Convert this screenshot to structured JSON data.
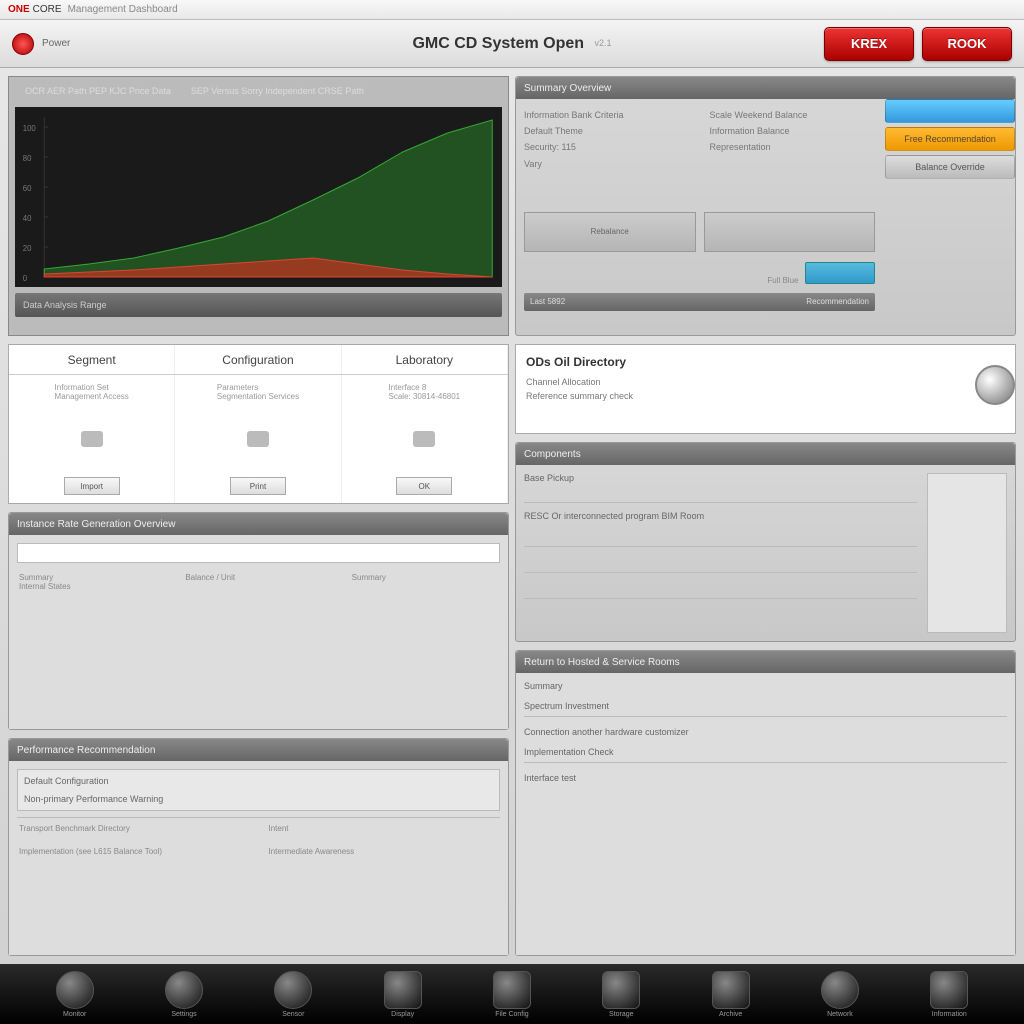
{
  "topbar": {
    "brand": "ONE",
    "brand2": "CORE",
    "subtitle": "Management Dashboard"
  },
  "header": {
    "icon_label": "Power",
    "title": "GMC CD System Open",
    "sub": "v2.1",
    "btn1": "KREX",
    "btn2": "ROOK"
  },
  "left": {
    "chart": {
      "tab1": "OCR AER Path PEP KJC Price Data",
      "tab2": "SEP Versus Sorry Independent CRSE Path",
      "footer": "Data Analysis Range"
    },
    "tricard": {
      "h1": "Segment",
      "h2": "Configuration",
      "h3": "Laboratory",
      "sub1a": "Information Set",
      "sub1b": "Management Access",
      "sub2a": "Parameters",
      "sub2b": "Segmentation Services",
      "sub3a": "Interface 8",
      "sub3b": "Scale: 30814-46801",
      "btn1": "Import",
      "btn2": "Print",
      "btn3": "OK"
    },
    "panelA": {
      "title": "Instance Rate Generation Overview",
      "c1h": "Summary",
      "c1a": "Internal States",
      "c2h": "Balance / Unit",
      "c3h": "Summary"
    },
    "panelB": {
      "title": "Performance Recommendation",
      "l1": "Default Configuration",
      "l2": "Non-primary Performance Warning",
      "f1": "Transport Benchmark Directory",
      "f2": "Implementation (see L615 Balance Tool)",
      "f3": "Intent",
      "f4": "Intermediate Awareness"
    }
  },
  "right": {
    "summary": {
      "title": "Summary Overview",
      "l1": "Information Bank Criteria",
      "l2": "Default Theme",
      "l3": "Security: 115",
      "l4": "Vary",
      "r1": "Scale Weekend Balance",
      "r2": "Information Balance",
      "r3": "Representation",
      "act1": "",
      "act2": "Free Recommendation",
      "act3": "Balance Override",
      "box1": "Rebalance",
      "box2": "",
      "pill_label": "Full Blue",
      "strip_l": "Last 5892",
      "strip_r": "Recommendation"
    },
    "info": {
      "title": "ODs Oil Directory",
      "l1": "Channel Allocation",
      "l2": "Reference summary check"
    },
    "panelC": {
      "title": "Components",
      "sub1": "Base Pickup",
      "sub2": "RESC Or interconnected program BIM Room",
      "sub3": "",
      "sub4": ""
    },
    "panelD": {
      "title": "Return to Hosted & Service Rooms",
      "l1": "Summary",
      "l2": "Spectrum Investment",
      "l3": "Connection another hardware customizer",
      "l4": "Implementation Check",
      "l5": "Interface test"
    }
  },
  "chart_data": {
    "type": "area",
    "title": "",
    "xlabel": "",
    "ylabel": "",
    "x": [
      0,
      10,
      20,
      30,
      40,
      50,
      60,
      70,
      80,
      90,
      100
    ],
    "series": [
      {
        "name": "green",
        "values": [
          5,
          8,
          12,
          18,
          25,
          35,
          48,
          62,
          78,
          90,
          98
        ],
        "color": "#2a6e2a"
      },
      {
        "name": "red",
        "values": [
          2,
          3,
          4,
          6,
          8,
          10,
          12,
          8,
          4,
          2,
          0
        ],
        "color": "#cc3322"
      }
    ],
    "ylim": [
      0,
      100
    ],
    "y_ticks": [
      0,
      20,
      40,
      60,
      80,
      100
    ]
  },
  "dock": [
    {
      "label": "Monitor",
      "shape": "round"
    },
    {
      "label": "Settings",
      "shape": "round"
    },
    {
      "label": "Sensor",
      "shape": "round"
    },
    {
      "label": "Display",
      "shape": "square"
    },
    {
      "label": "File Config",
      "shape": "square"
    },
    {
      "label": "Storage",
      "shape": "square"
    },
    {
      "label": "Archive",
      "shape": "square"
    },
    {
      "label": "Network",
      "shape": "round"
    },
    {
      "label": "Information",
      "shape": "square"
    }
  ]
}
